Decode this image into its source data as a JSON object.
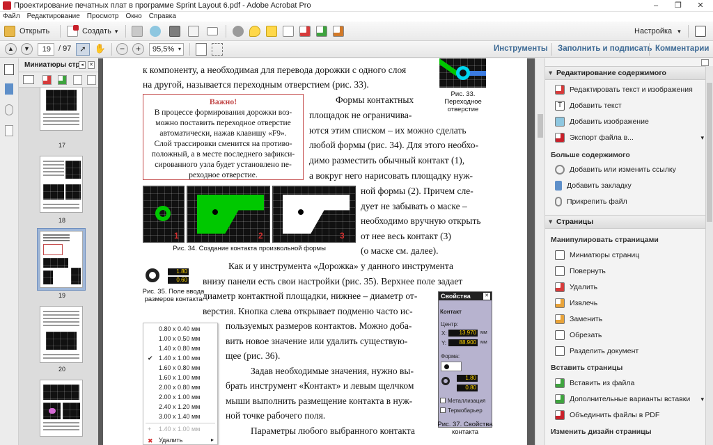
{
  "window": {
    "title": "Проектирование печатных плат в программе Sprint Layout 6.pdf - Adobe Acrobat Pro",
    "minimize": "–",
    "maximize": "❐",
    "close": "✕"
  },
  "menu": [
    "Файл",
    "Редактирование",
    "Просмотр",
    "Окно",
    "Справка"
  ],
  "toolbar": {
    "open": "Открыть",
    "create": "Создать",
    "create_arrow": "▾",
    "settings": "Настройка",
    "settings_arrow": "▾"
  },
  "nav": {
    "page_current": "19",
    "page_total": "/ 97",
    "zoom": "95,5%",
    "zoom_arrow": "▾",
    "tools": "Инструменты",
    "fill_sign": "Заполнить и подписать",
    "comments": "Комментарии"
  },
  "thumbs": {
    "title": "Миниатюры стр...",
    "pages": [
      "17",
      "18",
      "19",
      "20"
    ]
  },
  "doc": {
    "l1": "к компоненту, а необходимая для перевода дорожки с одного слоя",
    "l2": "на другой, называется переходным отверстием (рис. 33).",
    "fig33": "Рис. 33. Переходное отверстие",
    "important_title": "Важно!",
    "important": [
      "В процессе формирования дорожки воз-",
      "можно поставить переходное отверстие",
      "автоматически, нажав клавишу «F9».",
      "Слой трассировки сменится на противо-",
      "положный, а в месте последнего зафикси-",
      "сированного узла будет установлено пе-",
      "реходное отверстие."
    ],
    "r1": "Формы      контактных",
    "r2": "площадок  не  ограничива-",
    "r3": "ются этим списком – их можно сделать",
    "r4": "любой формы (рис. 34). Для этого необхо-",
    "r5": "димо  разместить  обычный  контакт  (1),",
    "r6": "а вокруг него нарисовать площадку нуж-",
    "s1": "ной  формы  (2).  Причем  сле-",
    "s2": "дует  не  забывать  о  маске  –",
    "s3": "необходимо вручную открыть",
    "s4": "от   нее   весь   контакт   (3)",
    "s5": "(о маске см. далее).",
    "fig34": "Рис. 34. Создание контакта произвольной формы",
    "panel_nums": [
      "1",
      "2",
      "3"
    ],
    "p1": "Как и у инструмента «Дорожка» у данного инструмента",
    "p2": "внизу панели есть свои настройки (рис. 35). Верхнее поле задает",
    "p3": "диаметр контактной площадки, нижнее – диаметр от-",
    "p4": "верстия. Кнопка слева открывает подменю часто ис-",
    "p5": "пользуемых размеров контактов. Можно доба-",
    "p6": "вить новое значение или удалить существую-",
    "p7": "щее (рис. 36).",
    "p8": "Задав необходимые значения, нужно вы-",
    "p9": "брать инструмент «Контакт» и левым щелчком",
    "p10": "мыши выполнить размещение контакта в нуж-",
    "p11": "ной точке рабочего поля.",
    "p12": "Параметры любого выбранного контакта",
    "fig35": "Рис. 35. Поле ввода размеров контакта",
    "fig35_vals": [
      "1.80",
      "0.60"
    ],
    "sizes": [
      "0.80  x  0.40    мм",
      "1.00  x  0.50    мм",
      "1.40  x  0.80    мм",
      "1.40  x  1.00    мм",
      "1.60  x  0.80    мм",
      "1.60  x  1.00    мм",
      "2.00  x  0.80    мм",
      "2.00  x  1.00    мм",
      "2.40  x  1.20    мм",
      "3.00  x  1.40    мм"
    ],
    "size_check": "✔",
    "size_add": "1.40  x  1.00    мм",
    "size_delete": "Удалить",
    "props": {
      "title": "Свойства",
      "close": "✕",
      "section": "Контакт",
      "center": "Центр:",
      "x_label": "X:",
      "x": "13.970",
      "y_label": "Y:",
      "y": "88.900",
      "unit": "мм",
      "shape": "Форма:",
      "d1": "1.80",
      "d2": "0.80",
      "metal": "Металлизация",
      "thermo": "Термобарьер"
    },
    "fig37": "Рис. 37. Свойства контакта"
  },
  "right": {
    "edit_header": "Редактирование содержимого",
    "edit_items": [
      "Редактировать текст и изображения",
      "Добавить текст",
      "Добавить изображение",
      "Экспорт файла в..."
    ],
    "more_header": "Больше содержимого",
    "more_items": [
      "Добавить или изменить ссылку",
      "Добавить закладку",
      "Прикрепить файл"
    ],
    "pages_header": "Страницы",
    "manip_header": "Манипулировать страницами",
    "manip_items": [
      "Миниатюры страниц",
      "Повернуть",
      "Удалить",
      "Извлечь",
      "Заменить",
      "Обрезать",
      "Разделить документ"
    ],
    "insert_header": "Вставить страницы",
    "insert_items": [
      "Вставить из файла",
      "Дополнительные варианты вставки",
      "Объединить файлы в PDF"
    ],
    "design_header": "Изменить дизайн страницы"
  },
  "colors": {
    "accent": "#3d6a95",
    "acrobat_red": "#c8202a",
    "copper": "#00c800"
  }
}
